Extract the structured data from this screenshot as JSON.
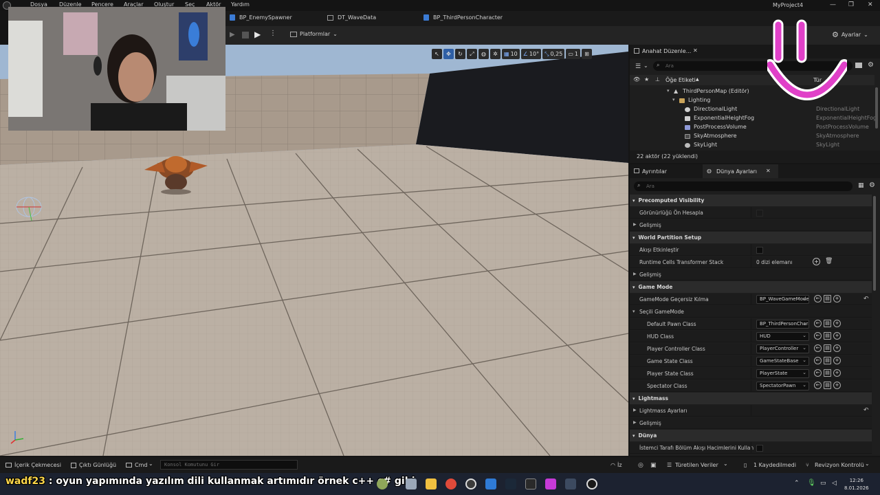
{
  "menu": {
    "items": [
      "Dosya",
      "Düzenle",
      "Pencere",
      "Araçlar",
      "Oluştur",
      "Seç",
      "Aktör",
      "Yardım"
    ],
    "project_name": "MyProject4"
  },
  "tabs": {
    "enemy_spawner": "BP_EnemySpawner",
    "wave_data": "DT_WaveData",
    "third_person": "BP_ThirdPersonCharacter"
  },
  "toolbar": {
    "platforms": "Platformlar",
    "settings": "Ayarlar"
  },
  "viewport": {
    "grid_snap": "10",
    "rotation_snap": "10°",
    "scale_snap": "0,25",
    "camera_speed": "1"
  },
  "outliner": {
    "tab_title": "Anahat Düzenle...",
    "search_placeholder": "Ara",
    "col_label": "Öğe Etiketi",
    "col_type": "Tür",
    "rows": [
      {
        "name": "ThirdPersonMap (Editör)",
        "type": "",
        "indent": 0
      },
      {
        "name": "Lighting",
        "type": "",
        "indent": 1
      },
      {
        "name": "DirectionalLight",
        "type": "DirectionalLight",
        "indent": 2
      },
      {
        "name": "ExponentialHeightFog",
        "type": "ExponentialHeightFog",
        "indent": 2
      },
      {
        "name": "PostProcessVolume",
        "type": "PostProcessVolume",
        "indent": 2
      },
      {
        "name": "SkyAtmosphere",
        "type": "SkyAtmosphere",
        "indent": 2
      },
      {
        "name": "SkyLight",
        "type": "SkyLight",
        "indent": 2
      }
    ],
    "actor_count": "22 aktör (22 yüklendi)"
  },
  "details": {
    "tab_details": "Ayrıntılar",
    "tab_world": "Dünya Ayarları",
    "search_placeholder": "Ara",
    "sections": {
      "precomputed": "Precomputed Visibility",
      "precomputed_prop": "Görünürlüğü Ön Hesapla",
      "advanced": "Gelişmiş",
      "world_partition": "World Partition Setup",
      "enable_streaming": "Akışı Etkinleştir",
      "runtime_cells": "Runtime Cells Transformer Stack",
      "array_elements": "0 dizi elemanı",
      "game_mode": "Game Mode",
      "gamemode_override": "GameMode Geçersiz Kılma",
      "gamemode_value": "BP_WaveGameMode",
      "selected_gamemode": "Seçili GameMode",
      "lightmass": "Lightmass",
      "lightmass_settings": "Lightmass Ayarları",
      "world": "Dünya",
      "client_side": "İstemci Tarafı Bölüm Akışı Hacimlerini Kullan"
    },
    "gamemode_props": [
      {
        "label": "Default Pawn Class",
        "value": "BP_ThirdPersonCharacter"
      },
      {
        "label": "HUD Class",
        "value": "HUD"
      },
      {
        "label": "Player Controller Class",
        "value": "PlayerController"
      },
      {
        "label": "Game State Class",
        "value": "GameStateBase"
      },
      {
        "label": "Player State Class",
        "value": "PlayerState"
      },
      {
        "label": "Spectator Class",
        "value": "SpectatorPawn"
      }
    ]
  },
  "statusbar": {
    "content_drawer": "İçerik Çekmecesi",
    "output_log": "Çıktı Günlüğü",
    "cmd": "Cmd",
    "console_placeholder": "Konsol Komutunu Gir",
    "derived_data": "Türetilen Veriler",
    "unsaved": "1 Kaydedilmedi",
    "revision": "Revizyon Kontrolü",
    "iz": "İz"
  },
  "taskbar": {
    "subtitle_name": "wadf23",
    "subtitle_text": ": oyun yapımında yazılım dili kullanmak artımıdır örnek c++ c# gibi",
    "time": "12:26",
    "date": "8.01.2026"
  },
  "colors": {
    "accent_blue": "#2f5fa5",
    "overlay_pink": "#e040c8",
    "floor": "#b9aea2",
    "wall": "#a99b8d"
  }
}
